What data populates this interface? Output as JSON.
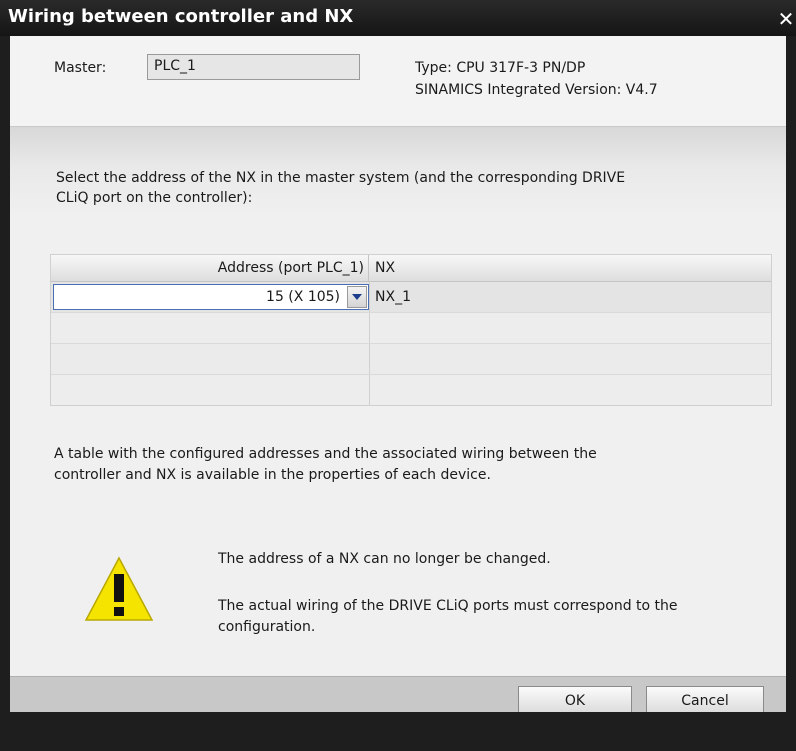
{
  "window": {
    "title": "Wiring between controller and NX",
    "close_glyph": "✕"
  },
  "master": {
    "label": "Master:",
    "value": "PLC_1"
  },
  "device_info": {
    "type_line": "Type: CPU 317F-3 PN/DP",
    "version_line": "SINAMICS Integrated Version: V4.7"
  },
  "instruction": "Select the address of the NX in the master system (and the corresponding DRIVE CLiQ port on the controller):",
  "table": {
    "columns": [
      "Address (port PLC_1)",
      "NX"
    ],
    "rows": [
      {
        "address": "15 (X 105)",
        "nx": "NX_1"
      }
    ]
  },
  "info_text": "A table with the configured addresses and the associated wiring between the controller and NX is available in the properties of each device.",
  "warning": {
    "icon": "warning-triangle-icon",
    "line1": "The address of a NX can no longer be changed.",
    "line2": "The actual wiring of the DRIVE CLiQ ports must correspond to the configuration."
  },
  "buttons": {
    "ok": "OK",
    "cancel": "Cancel"
  },
  "colors": {
    "title_bar": "#1e1e1e",
    "select_border": "#4a6fb0",
    "warning_yellow": "#f5e400"
  }
}
